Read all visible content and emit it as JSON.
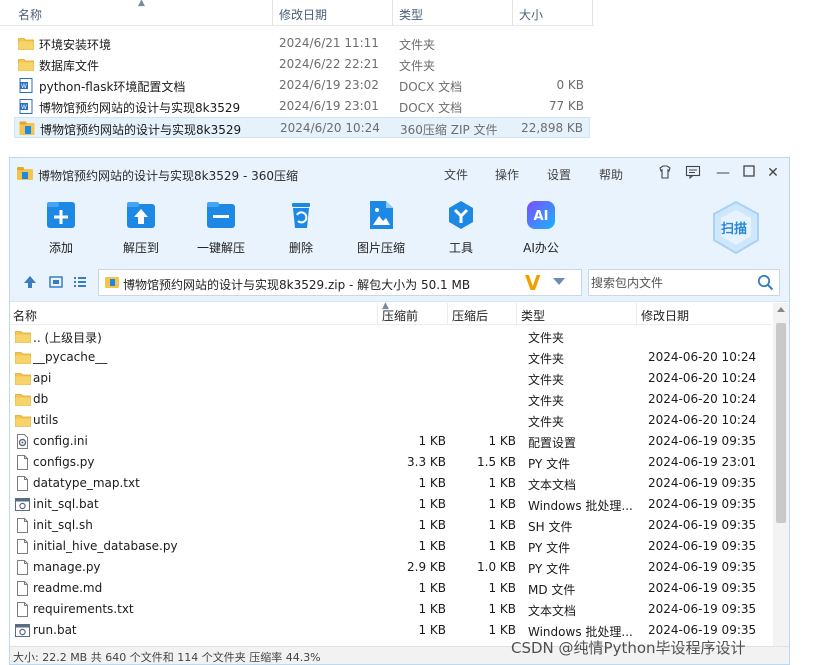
{
  "explorer": {
    "columns": {
      "name": "名称",
      "date": "修改日期",
      "type": "类型",
      "size": "大小"
    },
    "rows": [
      {
        "name": "环境安装环境",
        "date": "2024/6/21 11:11",
        "type": "文件夹",
        "size": "",
        "icon": "folder-icon"
      },
      {
        "name": "数据库文件",
        "date": "2024/6/22 22:21",
        "type": "文件夹",
        "size": "",
        "icon": "folder-icon"
      },
      {
        "name": "python-flask环境配置文档",
        "date": "2024/6/19 23:02",
        "type": "DOCX 文档",
        "size": "0 KB",
        "icon": "word-doc-icon"
      },
      {
        "name": "博物馆预约网站的设计与实现8k3529",
        "date": "2024/6/19 23:01",
        "type": "DOCX 文档",
        "size": "77 KB",
        "icon": "word-doc-icon"
      },
      {
        "name": "博物馆预约网站的设计与实现8k3529",
        "date": "2024/6/20 10:24",
        "type": "360压缩 ZIP 文件",
        "size": "22,898 KB",
        "icon": "zip-archive-icon",
        "selected": true
      }
    ]
  },
  "window": {
    "title": "博物馆预约网站的设计与实现8k3529 - 360压缩",
    "menu": [
      "文件",
      "操作",
      "设置",
      "帮助"
    ],
    "toolbar": [
      {
        "label": "添加",
        "icon": "add-icon"
      },
      {
        "label": "解压到",
        "icon": "extract-to-icon"
      },
      {
        "label": "一键解压",
        "icon": "one-click-extract-icon"
      },
      {
        "label": "删除",
        "icon": "delete-icon"
      },
      {
        "label": "图片压缩",
        "icon": "image-compress-icon"
      },
      {
        "label": "工具",
        "icon": "tools-icon"
      },
      {
        "label": "AI办公",
        "icon": "ai-office-icon"
      }
    ],
    "scan_label": "扫描",
    "path": "博物馆预约网站的设计与实现8k3529.zip - 解包大小为 50.1 MB",
    "path_badge": "V",
    "search_placeholder": "搜索包内文件",
    "list_columns": {
      "name": "名称",
      "compressed": "压缩前",
      "original": "压缩后",
      "type": "类型",
      "date": "修改日期"
    },
    "files": [
      {
        "name": ".. (上级目录)",
        "comp": "",
        "orig": "",
        "type": "文件夹",
        "date": "",
        "icon": "folder-icon"
      },
      {
        "name": "__pycache__",
        "comp": "",
        "orig": "",
        "type": "文件夹",
        "date": "2024-06-20 10:24",
        "icon": "folder-icon"
      },
      {
        "name": "api",
        "comp": "",
        "orig": "",
        "type": "文件夹",
        "date": "2024-06-20 10:24",
        "icon": "folder-icon"
      },
      {
        "name": "db",
        "comp": "",
        "orig": "",
        "type": "文件夹",
        "date": "2024-06-20 10:24",
        "icon": "folder-icon"
      },
      {
        "name": "utils",
        "comp": "",
        "orig": "",
        "type": "文件夹",
        "date": "2024-06-20 10:24",
        "icon": "folder-icon"
      },
      {
        "name": "config.ini",
        "comp": "1 KB",
        "orig": "1 KB",
        "type": "配置设置",
        "date": "2024-06-19 09:35",
        "icon": "config-file-icon"
      },
      {
        "name": "configs.py",
        "comp": "3.3 KB",
        "orig": "1.5 KB",
        "type": "PY 文件",
        "date": "2024-06-19 23:01",
        "icon": "file-icon"
      },
      {
        "name": "datatype_map.txt",
        "comp": "1 KB",
        "orig": "1 KB",
        "type": "文本文档",
        "date": "2024-06-19 09:35",
        "icon": "file-icon"
      },
      {
        "name": "init_sql.bat",
        "comp": "1 KB",
        "orig": "1 KB",
        "type": "Windows 批处理...",
        "date": "2024-06-19 09:35",
        "icon": "batch-file-icon"
      },
      {
        "name": "init_sql.sh",
        "comp": "1 KB",
        "orig": "1 KB",
        "type": "SH 文件",
        "date": "2024-06-19 09:35",
        "icon": "file-icon"
      },
      {
        "name": "initial_hive_database.py",
        "comp": "1 KB",
        "orig": "1 KB",
        "type": "PY 文件",
        "date": "2024-06-19 09:35",
        "icon": "file-icon"
      },
      {
        "name": "manage.py",
        "comp": "2.9 KB",
        "orig": "1.0 KB",
        "type": "PY 文件",
        "date": "2024-06-19 09:35",
        "icon": "file-icon"
      },
      {
        "name": "readme.md",
        "comp": "1 KB",
        "orig": "1 KB",
        "type": "MD 文件",
        "date": "2024-06-19 09:35",
        "icon": "file-icon"
      },
      {
        "name": "requirements.txt",
        "comp": "1 KB",
        "orig": "1 KB",
        "type": "文本文档",
        "date": "2024-06-19 09:35",
        "icon": "file-icon"
      },
      {
        "name": "run.bat",
        "comp": "1 KB",
        "orig": "1 KB",
        "type": "Windows 批处理...",
        "date": "2024-06-19 09:35",
        "icon": "batch-file-icon"
      }
    ],
    "status": "大小: 22.2 MB 共 640 个文件和 114 个文件夹 压缩率 44.3%"
  },
  "watermark": "CSDN @纯情Python毕设程序设计",
  "colors": {
    "accent": "#1e88e5",
    "titlebar": "#e8f3fd",
    "folder": "#f4c54a",
    "selection": "#e5f1fb",
    "badge": "#f1a000"
  }
}
